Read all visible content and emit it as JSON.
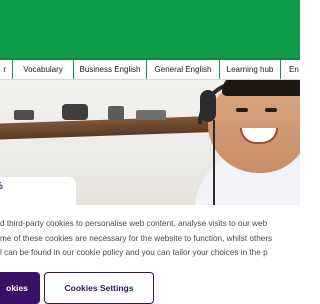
{
  "nav": {
    "tabs": [
      {
        "label": "r"
      },
      {
        "label": "Vocabulary"
      },
      {
        "label": "Business English"
      },
      {
        "label": "General English"
      },
      {
        "label": "Learning hub"
      },
      {
        "label": "En"
      }
    ]
  },
  "hero": {
    "card_text": "%"
  },
  "cookie": {
    "lines": [
      "d third-party cookies to personalise web content, analyse visits to our web",
      "me of these cookies are necessary for the website to function, whilst others",
      "l can be found in our cookie policy and you can tailor your choices in the p"
    ],
    "accept_label": "okies",
    "settings_label": "Cookies Settings"
  },
  "colors": {
    "brand_green": "#0f9b4b",
    "button_purple": "#3a0f66"
  }
}
